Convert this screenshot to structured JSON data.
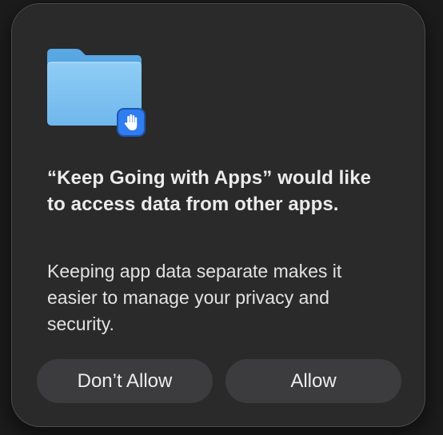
{
  "dialog": {
    "icon": "folder-icon",
    "badge_icon": "hand-icon",
    "title": "“Keep Going with Apps” would like to access data from other apps.",
    "message": "Keeping app data separate makes it easier to manage your privacy and security.",
    "buttons": {
      "deny_label": "Don’t Allow",
      "allow_label": "Allow"
    }
  },
  "colors": {
    "dialog_background": "#2a2a2b",
    "button_background": "#3c3c3e",
    "folder_blue": "#7cc3f2",
    "badge_blue": "#2f7df0",
    "text": "#ebebeb"
  }
}
